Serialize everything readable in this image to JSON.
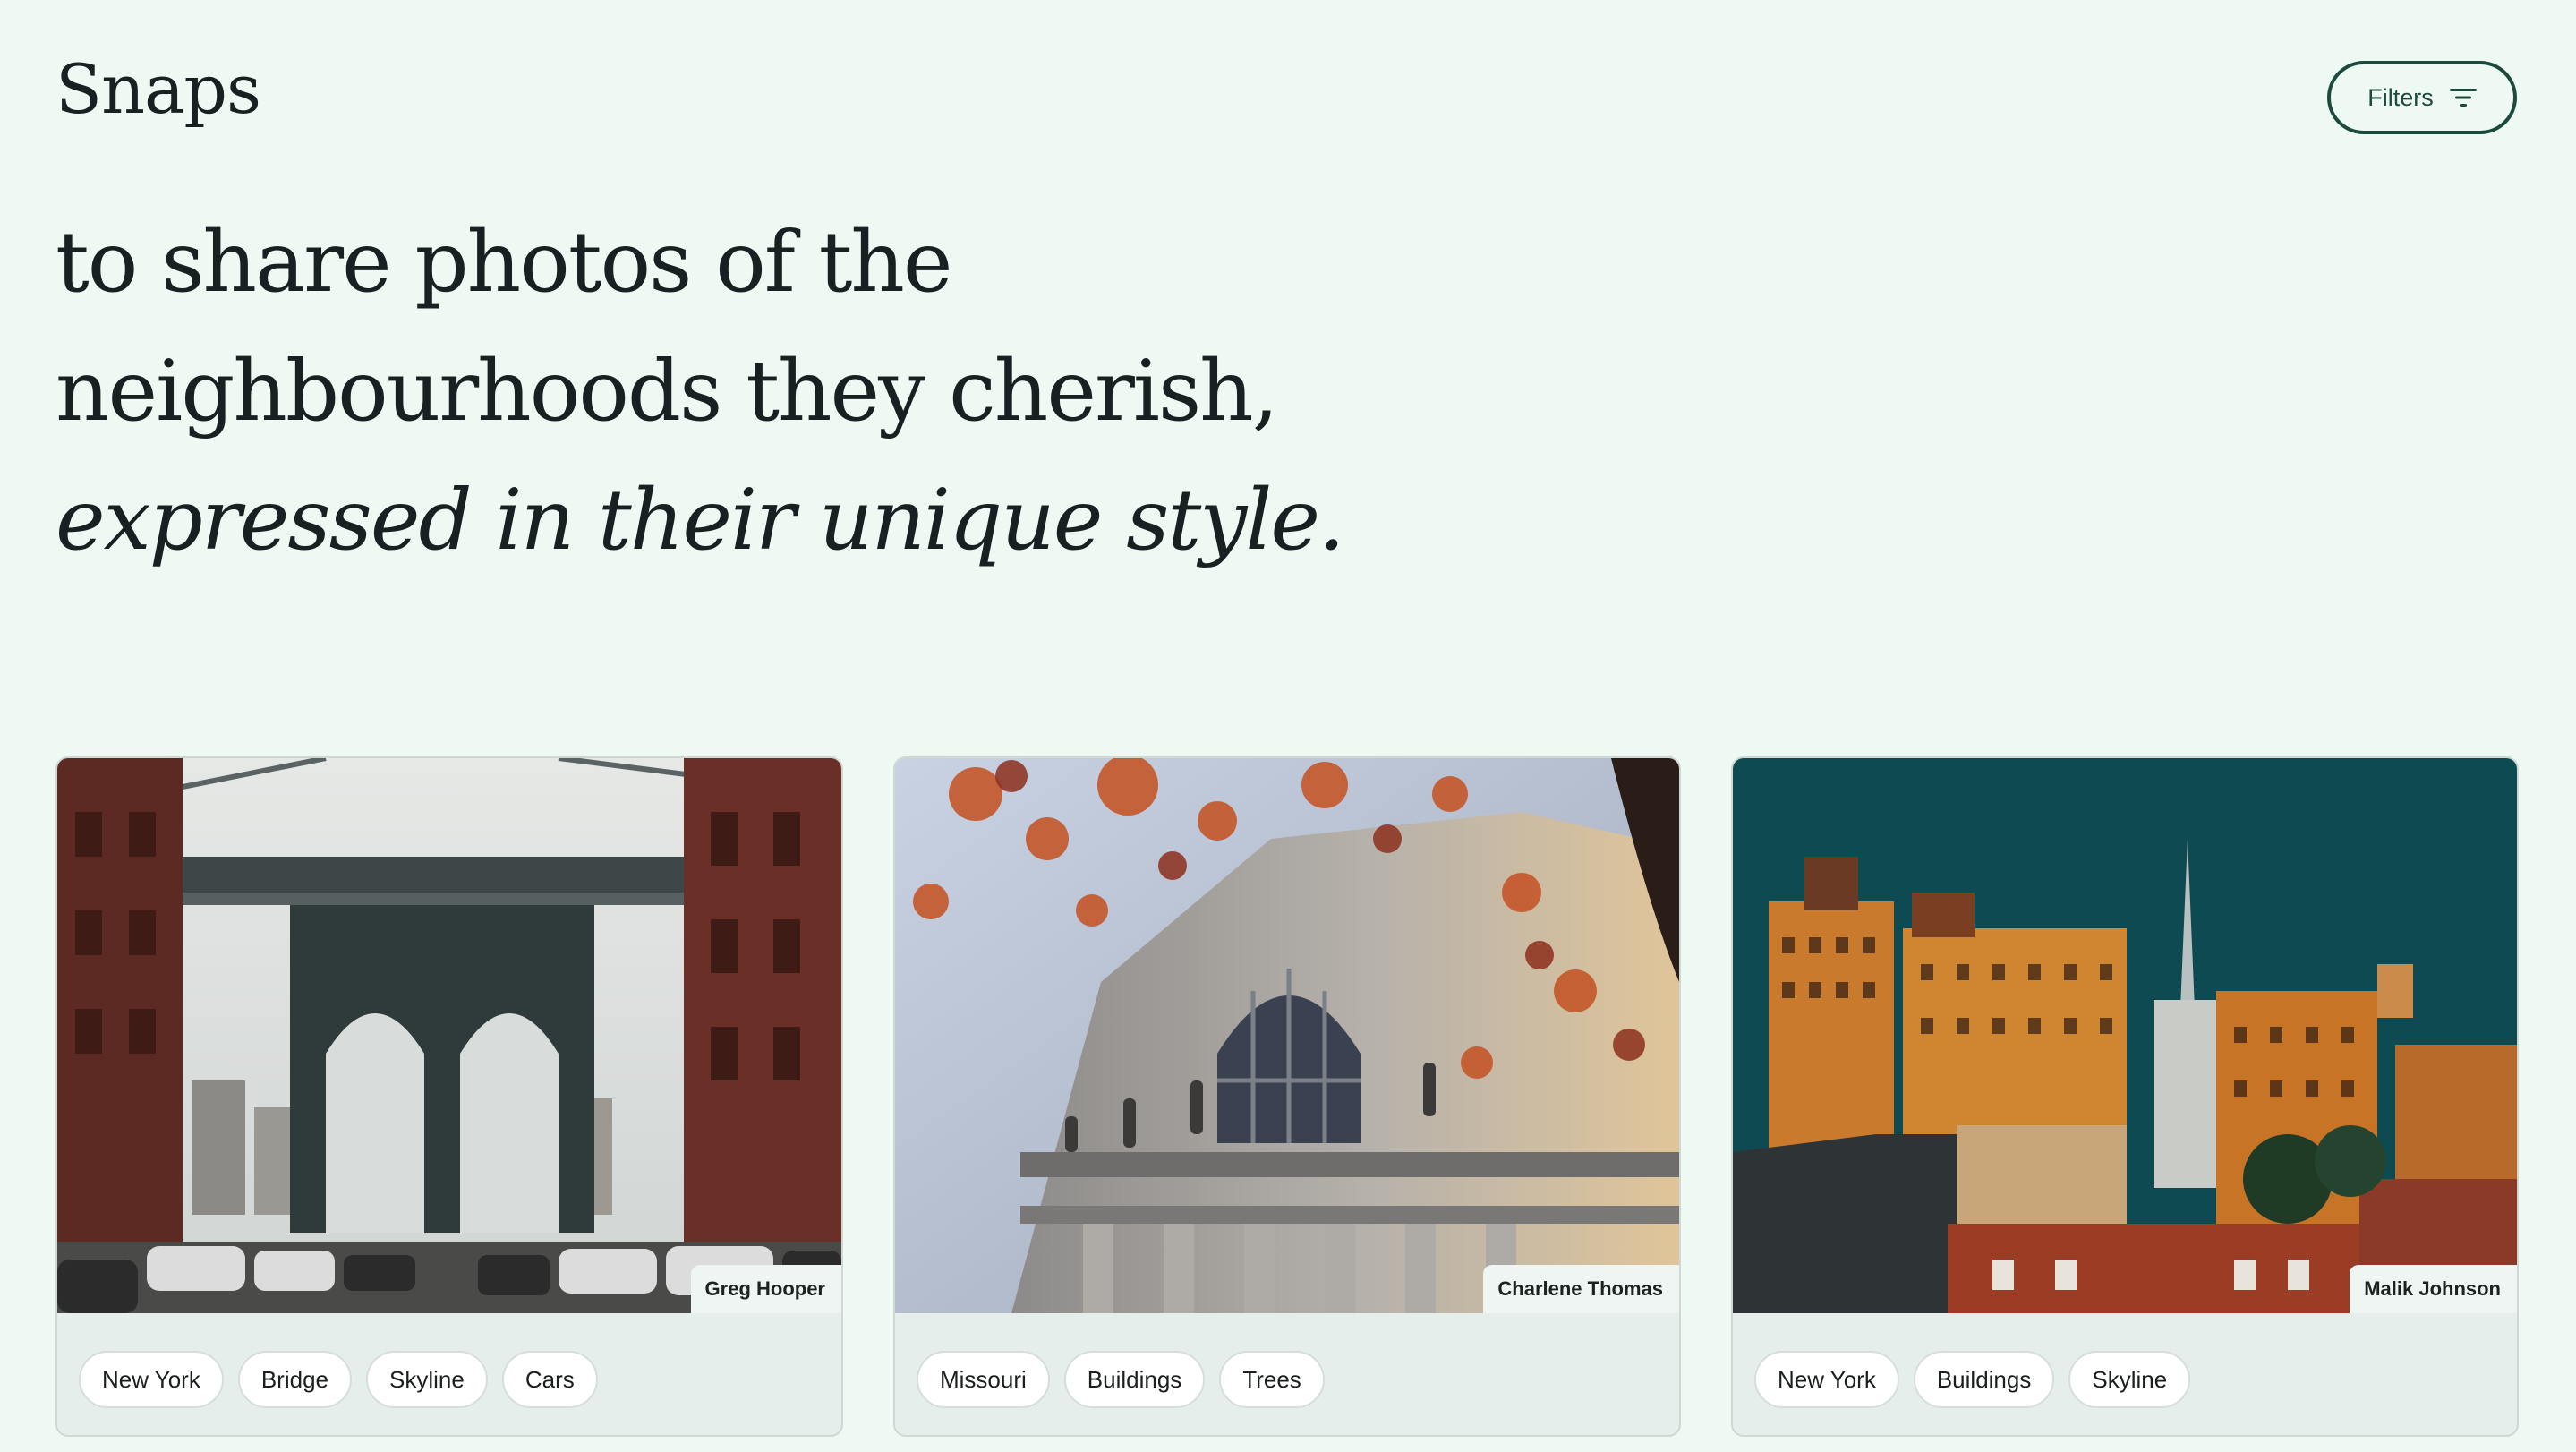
{
  "header": {
    "brand": "Snaps",
    "filters_label": "Filters",
    "filters_icon": "filter-lines-icon"
  },
  "hero": {
    "line1": "to share photos of the",
    "line2": "neighbourhoods they cherish,",
    "line3": "expressed in their unique style."
  },
  "cards": [
    {
      "photographer": "Greg Hooper",
      "tags": [
        "New York",
        "Bridge",
        "Skyline",
        "Cars"
      ]
    },
    {
      "photographer": "Charlene Thomas",
      "tags": [
        "Missouri",
        "Buildings",
        "Trees"
      ]
    },
    {
      "photographer": "Malik Johnson",
      "tags": [
        "New York",
        "Buildings",
        "Skyline"
      ]
    }
  ],
  "colors": {
    "background": "#eff9f4",
    "accent": "#1c4b3e",
    "text": "#172121"
  }
}
